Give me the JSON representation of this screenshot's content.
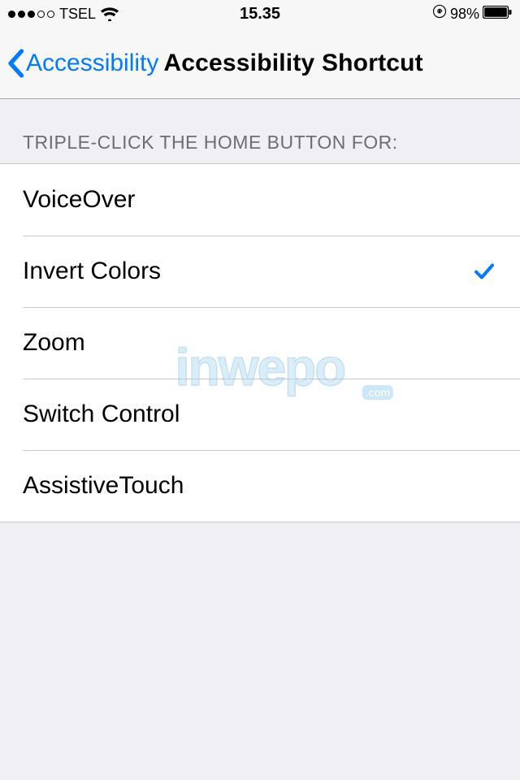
{
  "status": {
    "carrier": "TSEL",
    "time": "15.35",
    "battery_pct": "98%"
  },
  "nav": {
    "back_label": "Accessibility",
    "title": "Accessibility Shortcut"
  },
  "section": {
    "header": "TRIPLE-CLICK THE HOME BUTTON FOR:",
    "items": [
      {
        "label": "VoiceOver",
        "checked": false
      },
      {
        "label": "Invert Colors",
        "checked": true
      },
      {
        "label": "Zoom",
        "checked": false
      },
      {
        "label": "Switch Control",
        "checked": false
      },
      {
        "label": "AssistiveTouch",
        "checked": false
      }
    ]
  },
  "watermark": {
    "main": "inwepo",
    "sub": ".com"
  }
}
